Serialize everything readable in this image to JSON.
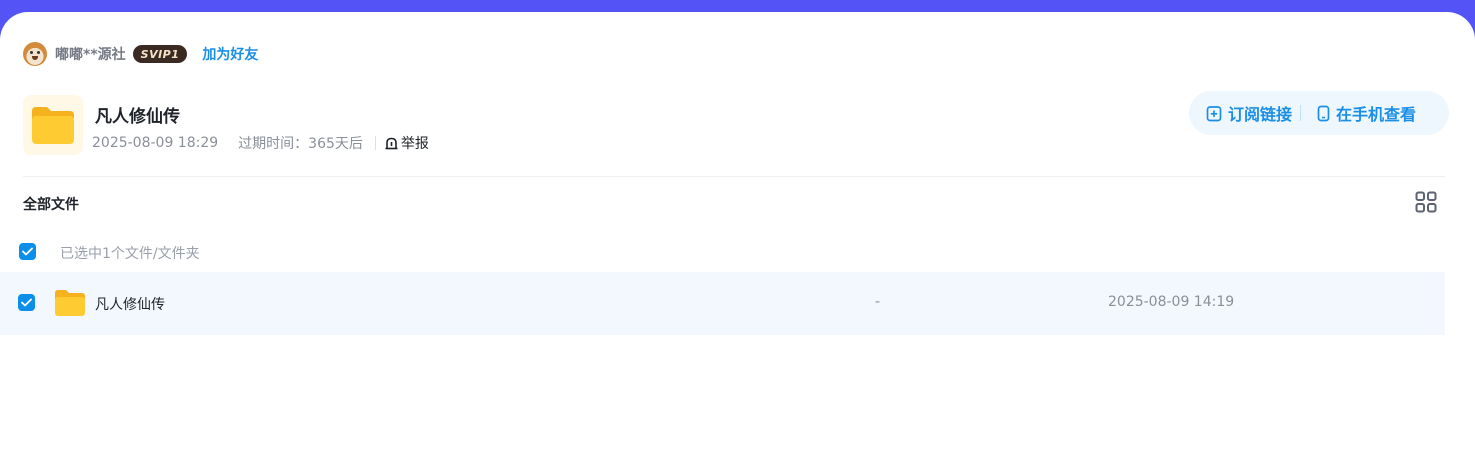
{
  "user": {
    "name": "嘟嘟**源社",
    "badge": "SVIP1",
    "add_friend": "加为好友"
  },
  "share": {
    "title": "凡人修仙传",
    "created": "2025-08-09 18:29",
    "expire": "过期时间：365天后",
    "report": "举报",
    "actions": {
      "subscribe": "订阅链接",
      "mobile": "在手机查看"
    }
  },
  "files": {
    "heading": "全部文件",
    "selected_text": "已选中1个文件/文件夹",
    "rows": [
      {
        "name": "凡人修仙传",
        "size": "-",
        "date": "2025-08-09 14:19",
        "checked": true
      }
    ]
  },
  "colors": {
    "accent": "#1b8fe6",
    "top_bar": "#5454f6",
    "selected_row": "#f2f8fe",
    "folder": "#ffc933"
  },
  "icons": [
    "avatar",
    "folder-icon",
    "report-icon",
    "subscribe-icon",
    "phone-icon",
    "grid-view-icon",
    "check-icon"
  ]
}
